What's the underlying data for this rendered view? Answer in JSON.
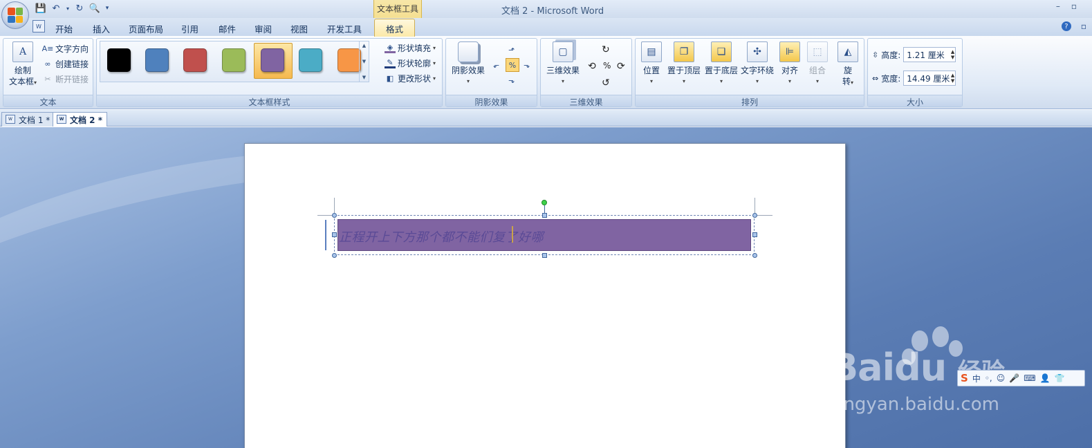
{
  "window": {
    "title": "文档 2 - Microsoft Word",
    "contextual_group": "文本框工具"
  },
  "tabs": [
    {
      "label": "开始"
    },
    {
      "label": "插入"
    },
    {
      "label": "页面布局"
    },
    {
      "label": "引用"
    },
    {
      "label": "邮件"
    },
    {
      "label": "审阅"
    },
    {
      "label": "视图"
    },
    {
      "label": "开发工具"
    },
    {
      "label": "格式",
      "active": true
    }
  ],
  "ribbon": {
    "text_group": {
      "label": "文本",
      "draw_textbox": "绘制\n文本框",
      "draw_textbox_line1": "绘制",
      "draw_textbox_line2": "文本框",
      "text_direction": "文字方向",
      "create_link": "创建链接",
      "break_link": "断开链接"
    },
    "textbox_styles": {
      "label": "文本框样式",
      "swatches": [
        "#000000",
        "#4f81bd",
        "#c0504d",
        "#9bbb59",
        "#8064a2",
        "#4bacc6",
        "#f79646"
      ],
      "selected_index": 4,
      "shape_fill": "形状填充",
      "shape_outline": "形状轮廓",
      "change_shape": "更改形状"
    },
    "shadow": {
      "label": "阴影效果",
      "shadow_effects": "阴影效果"
    },
    "three_d": {
      "label": "三维效果",
      "three_d_effects": "三维效果"
    },
    "arrange": {
      "label": "排列",
      "position": "位置",
      "bring_to_front": "置于顶层",
      "send_to_back": "置于底层",
      "text_wrap": "文字环绕",
      "align": "对齐",
      "group": "组合",
      "rotate_line1": "旋",
      "rotate_line2": "转"
    },
    "size": {
      "label": "大小",
      "height_label": "高度:",
      "height_value": "1.21 厘米",
      "width_label": "宽度:",
      "width_value": "14.49 厘米"
    }
  },
  "documents": [
    {
      "label": "文档 1 *"
    },
    {
      "label": "文档 2 *",
      "active": true
    }
  ],
  "document": {
    "textbox_text": "正程开上下方那个都不能们复了好哪",
    "textbox_fill": "#8064a2"
  },
  "watermark": {
    "brand": "Bai",
    "brand2": "du",
    "cn": "经验",
    "url": "jingyan.baidu.com"
  },
  "ime": {
    "logo": "S",
    "mode": "中"
  }
}
